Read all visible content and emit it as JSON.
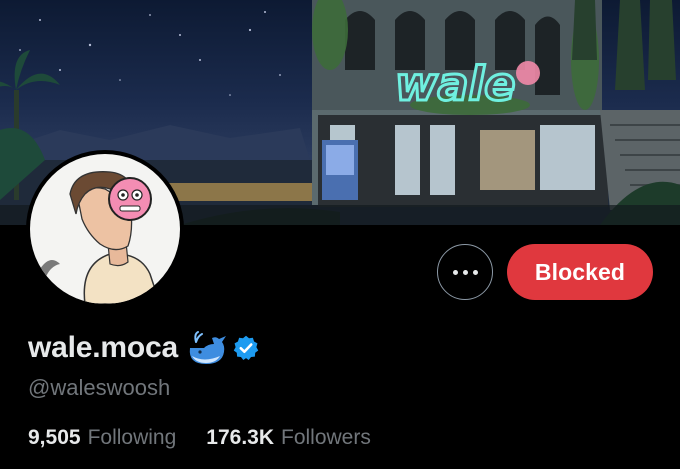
{
  "profile": {
    "display_name": "wale.moca",
    "handle": "@waleswoosh",
    "banner_sign_text": "wale",
    "whale_icon": "whale-emoji",
    "verified_icon": "verified-badge",
    "verified_color": "#1d9bf0"
  },
  "actions": {
    "more_icon": "more-options-dots",
    "blocked_label": "Blocked",
    "blocked_color": "#e0383e"
  },
  "stats": {
    "following_count": "9,505",
    "following_label": "Following",
    "followers_count": "176.3K",
    "followers_label": "Followers"
  }
}
